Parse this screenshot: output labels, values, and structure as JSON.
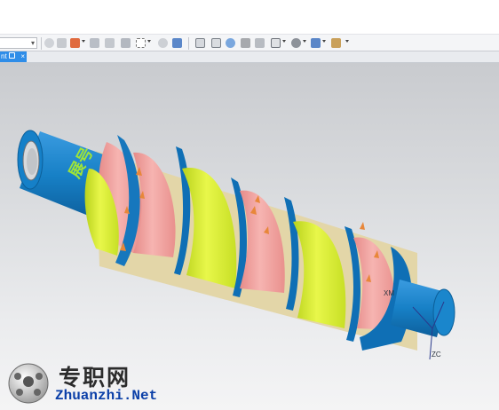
{
  "tab": {
    "label": "nt",
    "close_glyph": "×"
  },
  "model": {
    "engraving": "展号"
  },
  "axes": {
    "xm": "XM",
    "zc": "ZC"
  },
  "watermark": {
    "title": "专职网",
    "url": "Zhuanzhi.Net"
  },
  "colors": {
    "shaft": "#1780c6",
    "flight_edge": "#0f6fb5",
    "helix_yellow": "#d7ef33",
    "helix_pink": "#f1a2a0",
    "engrave_text": "#9ee33a",
    "tab_bg": "#2f8de8"
  },
  "toolbar_icons": [
    "dropdown",
    "measure-icon",
    "snap-icon",
    "select-icon",
    "move-icon",
    "rotate-icon",
    "copy-icon",
    "box-select-icon",
    "view-icon",
    "cube-icon",
    "sketch-icon",
    "layer-icon",
    "refresh-icon",
    "paint-icon",
    "edit-icon",
    "grid-icon",
    "render-icon",
    "solid-icon",
    "flag-icon"
  ]
}
